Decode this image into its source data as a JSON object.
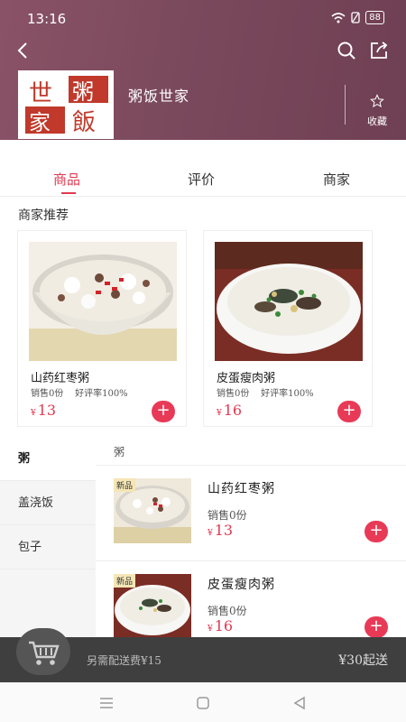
{
  "status_bar": {
    "time": "13:16",
    "battery": "88"
  },
  "header": {
    "shop_name": "粥饭世家",
    "favorite_label": "收藏",
    "logo_text": "粥饭世家"
  },
  "tabs": [
    "商品",
    "评价",
    "商家"
  ],
  "recommend": {
    "title": "商家推荐",
    "items": [
      {
        "name": "山药红枣粥",
        "sales": "销售0份",
        "rating": "好评率100%",
        "currency": "¥",
        "price": "13"
      },
      {
        "name": "皮蛋瘦肉粥",
        "sales": "销售0份",
        "rating": "好评率100%",
        "currency": "¥",
        "price": "16"
      }
    ]
  },
  "categories": [
    "粥",
    "盖浇饭",
    "包子"
  ],
  "list": {
    "section": "粥",
    "items": [
      {
        "badge": "新品",
        "name": "山药红枣粥",
        "sales": "销售0份",
        "currency": "¥",
        "price": "13"
      },
      {
        "badge": "新品",
        "name": "皮蛋瘦肉粥",
        "sales": "销售0份",
        "currency": "¥",
        "price": "16"
      }
    ]
  },
  "cart": {
    "delivery_fee": "另需配送费¥15",
    "min_order": "¥30起送"
  },
  "colors": {
    "accent": "#e03a52",
    "header": "#7c4a5d",
    "cart_bar": "#3f3f3f"
  }
}
